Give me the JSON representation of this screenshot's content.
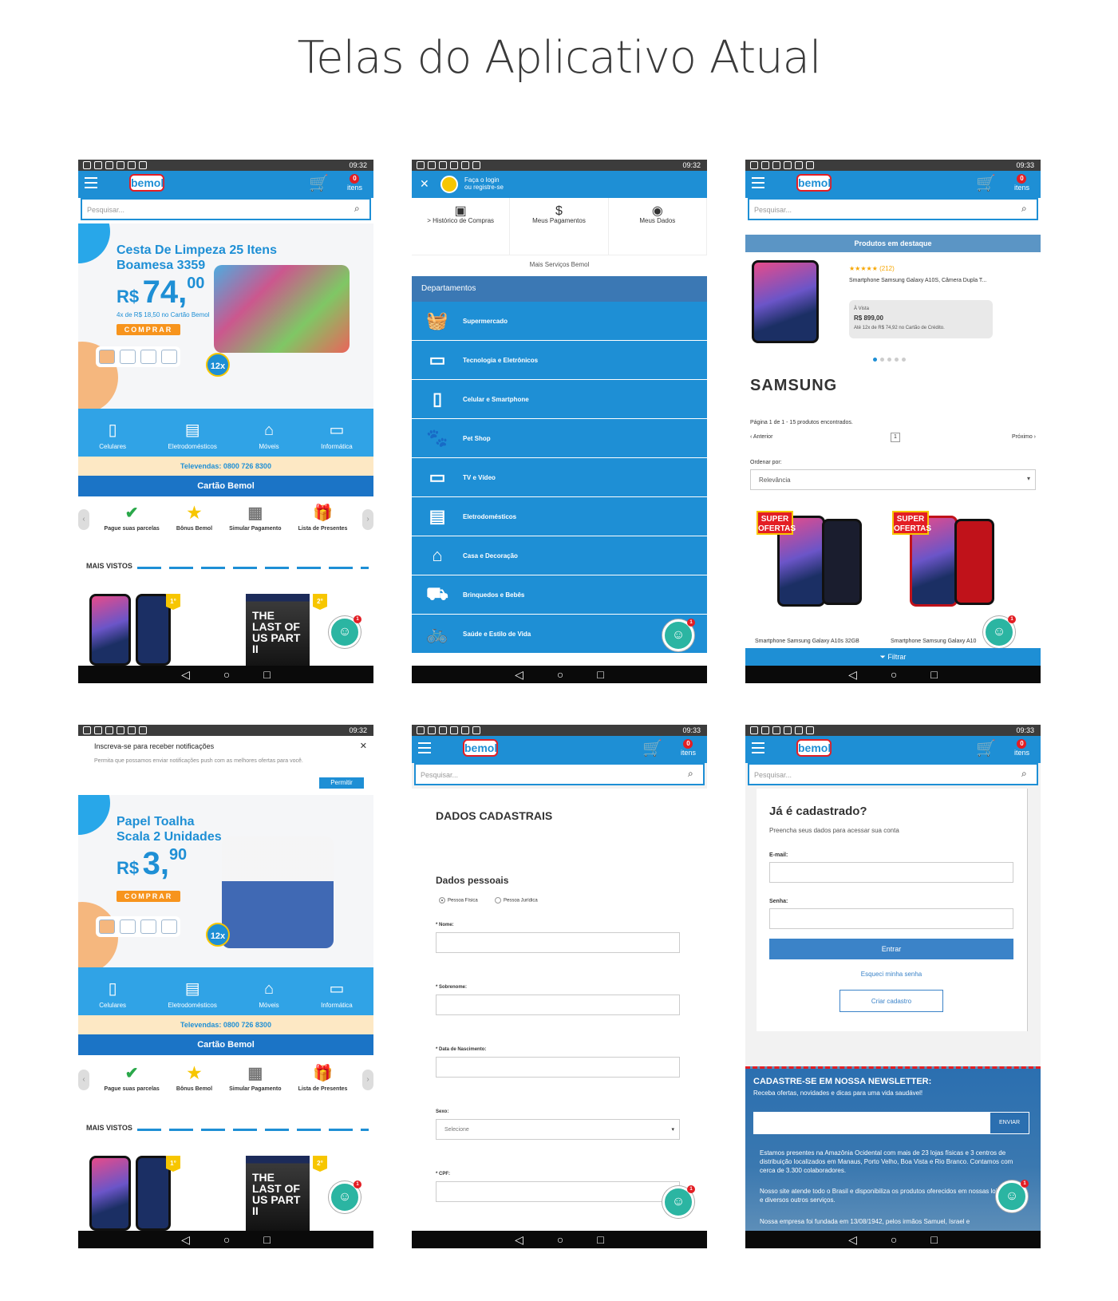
{
  "page_title": "Telas do Aplicativo Atual",
  "status": {
    "time_a": "09:32",
    "time_b": "09:33"
  },
  "nav": {
    "back": "◁",
    "home": "○",
    "recent": "□"
  },
  "appbar": {
    "logo": "bemol",
    "cart_count": "0",
    "cart_label": "itens"
  },
  "search": {
    "placeholder": "Pesquisar..."
  },
  "home": {
    "banner1": {
      "title_line1": "Cesta De Limpeza 25 Itens",
      "title_line2": "Boamesa 3359",
      "currency": "R$",
      "price_int": "74,",
      "price_cents": "00",
      "sub": "4x de R$ 18,50 no Cartão Bemol",
      "cta": "COMPRAR",
      "installments": "12x"
    },
    "banner2": {
      "title_line1": "Papel Toalha",
      "title_line2": "Scala 2 Unidades",
      "currency": "R$",
      "price_int": "3,",
      "price_cents": "90",
      "cta": "COMPRAR",
      "installments": "12x"
    },
    "categories": [
      {
        "label": "Celulares",
        "icon": "phone-icon"
      },
      {
        "label": "Eletrodomésticos",
        "icon": "appliance-icon"
      },
      {
        "label": "Móveis",
        "icon": "sofa-icon"
      },
      {
        "label": "Informática",
        "icon": "laptop-icon"
      }
    ],
    "televendas": "Televendas: 0800 726 8300",
    "cartao": "Cartão Bemol",
    "quick": [
      "Pague suas parcelas",
      "Bônus Bemol",
      "Simular Pagamento",
      "Lista de Presentes"
    ],
    "mais_vistos": "MAIS VISTOS",
    "rank1": "1°",
    "rank2": "2°",
    "game_title": "THE LAST OF US PART II"
  },
  "menu": {
    "login_line1": "Faça o login",
    "login_line2": "ou registre-se",
    "top": [
      {
        "label": "> Histórico de Compras",
        "icon": "history-icon"
      },
      {
        "label": "Meus Pagamentos",
        "icon": "dollar-icon"
      },
      {
        "label": "Meus Dados",
        "icon": "user-icon"
      }
    ],
    "mais_servicos": "Mais Serviços Bemol",
    "departamentos": "Departamentos",
    "items": [
      {
        "label": "Supermercado",
        "icon": "basket-icon"
      },
      {
        "label": "Tecnologia e Eletrônicos",
        "icon": "laptop-icon"
      },
      {
        "label": "Celular e Smartphone",
        "icon": "phone-icon"
      },
      {
        "label": "Pet Shop",
        "icon": "paw-icon"
      },
      {
        "label": "TV e Vídeo",
        "icon": "tv-icon"
      },
      {
        "label": "Eletrodomésticos",
        "icon": "fridge-icon"
      },
      {
        "label": "Casa e Decoração",
        "icon": "sofa-icon"
      },
      {
        "label": "Brinquedos e Bebês",
        "icon": "stroller-icon"
      },
      {
        "label": "Saúde e Estilo de Vida",
        "icon": "bike-icon"
      }
    ]
  },
  "search_page": {
    "destaque": "Produtos em destaque",
    "stars": "★★★★★ (212)",
    "product_name": "Smartphone Samsung Galaxy A10S, Câmera Dupla T...",
    "price_label": "À Vista",
    "price": "R$ 899,00",
    "installments": "Até 12x de R$ 74,92 no Cartão de Crédito.",
    "brand": "SAMSUNG",
    "pagina": "Página 1 de 1 - 15 produtos encontrados.",
    "anterior": "‹ Anterior",
    "page_num": "1",
    "proximo": "Próximo ›",
    "ordenar": "Ordenar por:",
    "ordenar_value": "Relevância",
    "super": "SUPER OFERTAS",
    "grid_name1": "Smartphone Samsung Galaxy A10s 32GB",
    "grid_name2": "Smartphone Samsung Galaxy A10",
    "filtrar": "Filtrar"
  },
  "notification": {
    "title": "Inscreva-se para receber notificações",
    "text": "Permita que possamos enviar notificações push com as melhores ofertas para você.",
    "button": "Permitir"
  },
  "form": {
    "title": "DADOS CADASTRAIS",
    "section": "Dados pessoais",
    "radio1": "Pessoa Física",
    "radio2": "Pessoa Jurídica",
    "nome": "* Nome:",
    "sobrenome": "* Sobrenome:",
    "nascimento": "* Data de Nascimento:",
    "sexo": "Sexo:",
    "sexo_value": "Selecione",
    "cpf": "* CPF:"
  },
  "login": {
    "title": "Já é cadastrado?",
    "subtitle": "Preencha seus dados para acessar sua conta",
    "email": "E-mail:",
    "senha": "Senha:",
    "entrar": "Entrar",
    "esqueci": "Esqueci minha senha",
    "criar": "Criar cadastro"
  },
  "newsletter": {
    "title": "CADASTRE-SE EM NOSSA NEWSLETTER:",
    "subtitle": "Receba ofertas, novidades e dicas para uma vida saudável!",
    "button": "ENVIAR",
    "p1": "Estamos presentes na Amazônia Ocidental com mais de 23 lojas físicas e 3 centros de distribuição localizados em Manaus, Porto Velho, Boa Vista e Rio Branco. Contamos com cerca de 3.300 colaboradores.",
    "p2": "Nosso site atende todo o Brasil e disponibiliza os produtos oferecidos em nossas lojas físicas e diversos outros serviços.",
    "p3": "Nossa empresa foi fundada em 13/08/1942, pelos irmãos Samuel, Israel e"
  }
}
